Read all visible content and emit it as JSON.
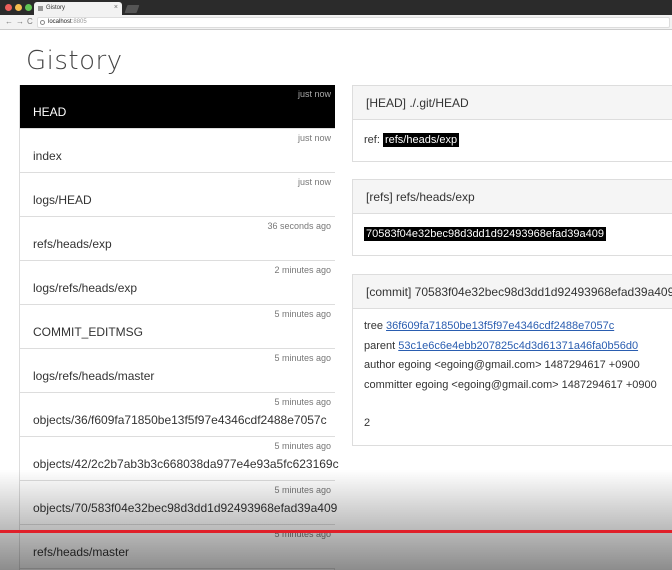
{
  "browser": {
    "tab_title": "Gistory",
    "tab_close": "×",
    "back": "←",
    "forward": "→",
    "reload": "C",
    "url_host": "localhost",
    "url_port": ":8805",
    "colors": {
      "close": "#ee5f5b",
      "minimize": "#f5bd4f",
      "maximize": "#61c454"
    }
  },
  "page": {
    "title": "Gistory"
  },
  "files": [
    {
      "name": "HEAD",
      "time": "just now",
      "active": true
    },
    {
      "name": "index",
      "time": "just now"
    },
    {
      "name": "logs/HEAD",
      "time": "just now"
    },
    {
      "name": "refs/heads/exp",
      "time": "36 seconds ago"
    },
    {
      "name": "logs/refs/heads/exp",
      "time": "2 minutes ago"
    },
    {
      "name": "COMMIT_EDITMSG",
      "time": "5 minutes ago"
    },
    {
      "name": "logs/refs/heads/master",
      "time": "5 minutes ago"
    },
    {
      "name": "objects/36/f609fa71850be13f5f97e4346cdf2488e7057c",
      "time": "5 minutes ago"
    },
    {
      "name": "objects/42/2c2b7ab3b3c668038da977e4e93a5fc623169c",
      "time": "5 minutes ago"
    },
    {
      "name": "objects/70/583f04e32bec98d3dd1d92493968efad39a409",
      "time": "5 minutes ago"
    },
    {
      "name": "refs/heads/master",
      "time": "5 minutes ago"
    }
  ],
  "panels": {
    "head": {
      "title": "[HEAD] ./.git/HEAD",
      "ref_label": "ref:",
      "ref_value": "refs/heads/exp"
    },
    "refs": {
      "title": "[refs] refs/heads/exp",
      "hash": "70583f04e32bec98d3dd1d92493968efad39a409"
    },
    "commit": {
      "title": "[commit] 70583f04e32bec98d3dd1d92493968efad39a409",
      "tree_label": "tree",
      "tree_hash": "36f609fa71850be13f5f97e4346cdf2488e7057c",
      "parent_label": "parent",
      "parent_hash": "53c1e6c6e4ebb207825c4d3d61371a46fa0b56d0",
      "author": "author egoing <egoing@gmail.com> 1487294617 +0900",
      "committer": "committer egoing <egoing@gmail.com> 1487294617 +0900",
      "message": "2"
    }
  }
}
